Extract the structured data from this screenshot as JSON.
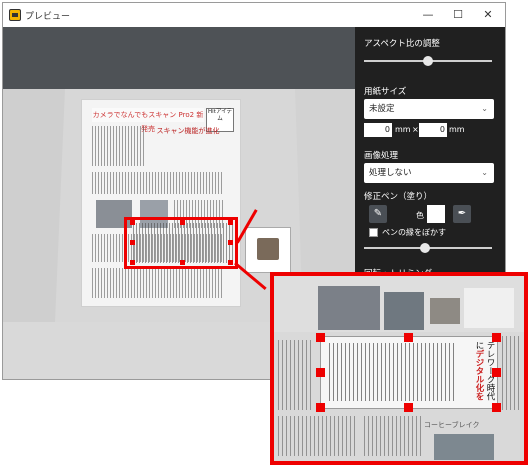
{
  "window": {
    "title": "プレビュー",
    "minimize": "—",
    "maximize": "☐",
    "close": "✕"
  },
  "document": {
    "header_title": "カメラでなんでもスキャン Pro2 新発売",
    "side_box": "Hitアイテム",
    "headline": "スキャン機能が進化"
  },
  "panel": {
    "aspect_label": "アスペクト比の調整",
    "aspect_slider_level": 0.5,
    "paper_size_label": "用紙サイズ",
    "paper_size_value": "未設定",
    "width_value": "0",
    "height_value": "0",
    "unit_mm_1": "mm",
    "times": "×",
    "unit_mm_2": "mm",
    "image_processing_label": "画像処理",
    "image_processing_value": "処理しない",
    "correction_pen_label": "修正ペン（塗り）",
    "color_label": "色",
    "blur_pen_label": "ペンの縁をぼかす",
    "pen_slider_level": 0.48,
    "rotate_trim_label": "回転・トリミング"
  },
  "zoom": {
    "side_text_1": "テレワーク時代に",
    "side_text_2": "デジタル化を",
    "bottom_text": "コーヒーブレイク"
  }
}
